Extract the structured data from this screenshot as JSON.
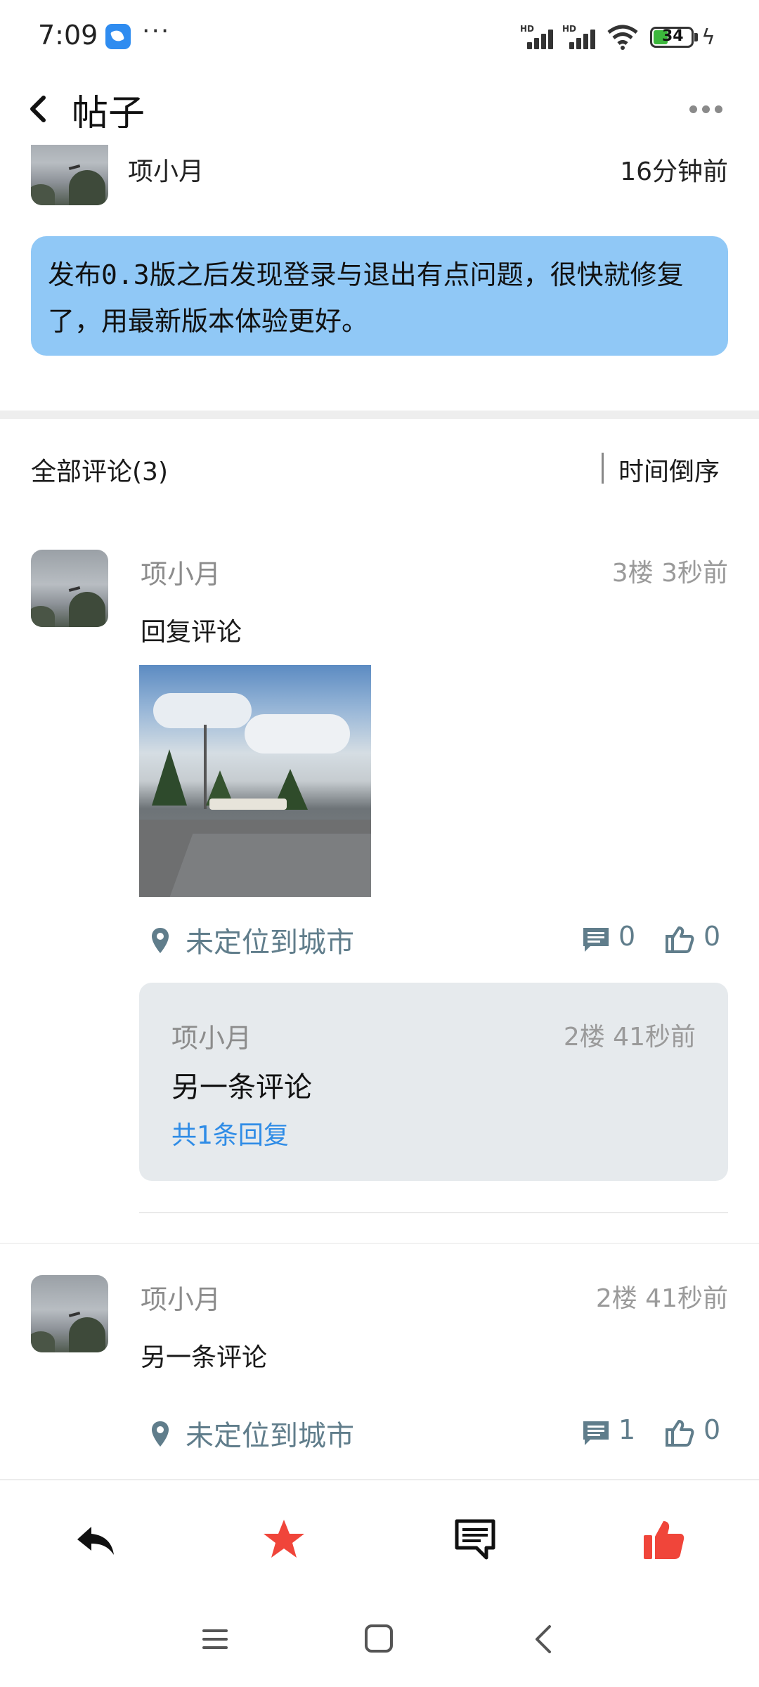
{
  "status_bar": {
    "time": "7:09",
    "more": "···",
    "hd1": "HD",
    "hd2": "HD",
    "battery": "34"
  },
  "header": {
    "title": "帖子"
  },
  "post": {
    "author": "项小月",
    "time": "16分钟前",
    "content": "发布0.3版之后发现登录与退出有点问题，很快就修复了，用最新版本体验更好。"
  },
  "comments": {
    "title": "全部评论(3)",
    "sort_label": "时间倒序",
    "items": [
      {
        "author": "项小月",
        "meta": "3楼  3秒前",
        "text": "回复评论",
        "location": "未定位到城市",
        "comment_count": "0",
        "like_count": "0",
        "reply": {
          "author": "项小月",
          "meta": "2楼  41秒前",
          "text": "另一条评论",
          "more": "共1条回复"
        }
      },
      {
        "author": "项小月",
        "meta": "2楼  41秒前",
        "text": "另一条评论",
        "location": "未定位到城市",
        "comment_count": "1",
        "like_count": "0"
      }
    ]
  },
  "colors": {
    "bubble": "#90c8f6",
    "accent_red": "#f0453a",
    "meta_blue_gray": "#607d8b",
    "link_blue": "#2f8ce6"
  }
}
